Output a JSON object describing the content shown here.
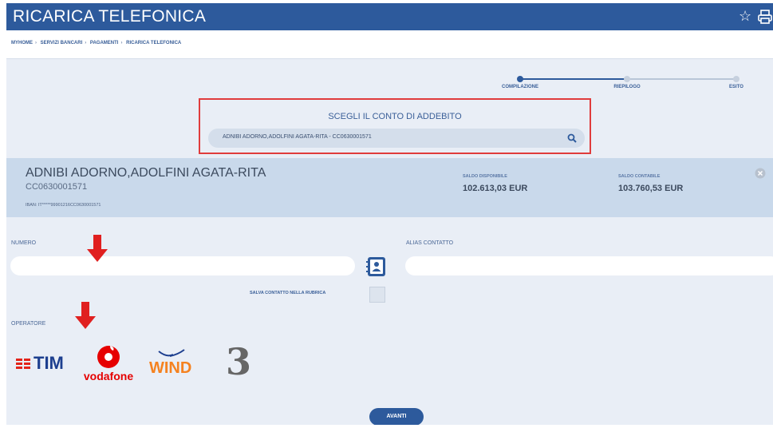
{
  "app": {
    "title": "RICARICA TELEFONICA",
    "favorite_icon": "star-icon",
    "print_icon": "printer-icon"
  },
  "breadcrumb": [
    "MYHOME",
    "SERVIZI BANCARI",
    "PAGAMENTI",
    "RICARICA TELEFONICA"
  ],
  "steps": [
    {
      "label": "COMPILAZIONE",
      "active": true
    },
    {
      "label": "RIEPILOGO",
      "active": false
    },
    {
      "label": "ESITO",
      "active": false
    }
  ],
  "conto": {
    "title": "SCEGLI IL CONTO DI ADDEBITO",
    "selected": "ADNIBI ADORNO,ADOLFINI AGATA-RITA - CC0630001571"
  },
  "account": {
    "name": "ADNIBI ADORNO,ADOLFINI AGATA-RITA",
    "code": "CC0630001571",
    "iban": "IBAN: IT*****99901216CC0630001571",
    "saldo_disponibile_label": "SALDO DISPONIBILE",
    "saldo_disponibile": "102.613,03 EUR",
    "saldo_contabile_label": "SALDO CONTABILE",
    "saldo_contabile": "103.760,53 EUR"
  },
  "form": {
    "numero_label": "NUMERO",
    "numero_value": "",
    "alias_label": "ALIAS CONTATTO",
    "alias_value": "",
    "save_contact_label": "SALVA CONTATTO NELLA RUBRICA",
    "save_contact_checked": false,
    "operatori_label": "OPERATORE"
  },
  "operators": [
    {
      "name": "TIM",
      "brand_color": "#e2231a"
    },
    {
      "name": "vodafone",
      "brand_color": "#e60000"
    },
    {
      "name": "WIND",
      "brand_color": "#f58220"
    },
    {
      "name": "3",
      "brand_color": "#555555"
    }
  ],
  "colors": {
    "primary": "#2d5a9c",
    "highlight_box": "#e03c3c",
    "arrow": "#e02020"
  },
  "actions": {
    "avanti_label": "AVANTI"
  }
}
